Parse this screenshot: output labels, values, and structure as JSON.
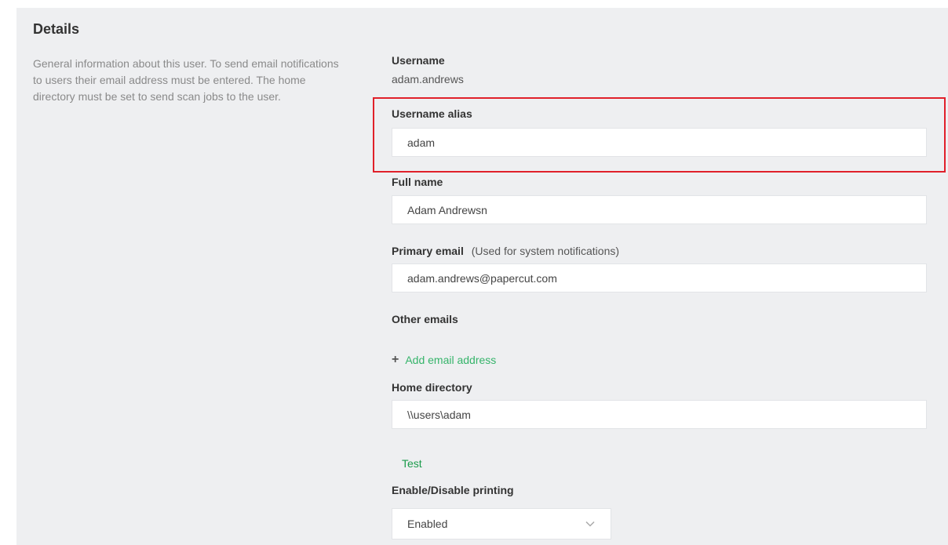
{
  "section": {
    "title": "Details",
    "description": "General information about this user. To send email notifications to users their email address must be entered. The home directory must be set to send scan jobs to the user."
  },
  "username": {
    "label": "Username",
    "value": "adam.andrews"
  },
  "username_alias": {
    "label": "Username alias",
    "value": "adam"
  },
  "full_name": {
    "label": "Full name",
    "value": "Adam Andrewsn"
  },
  "primary_email": {
    "label": "Primary email",
    "note": "(Used for system notifications)",
    "value": "adam.andrews@papercut.com"
  },
  "other_emails": {
    "label": "Other emails",
    "add_link": "Add email address"
  },
  "home_directory": {
    "label": "Home directory",
    "value": "\\\\users\\adam",
    "test_link": "Test"
  },
  "printing": {
    "label": "Enable/Disable printing",
    "selected": "Enabled"
  },
  "colors": {
    "highlight": "#e0202a",
    "link": "#35b46a",
    "panel": "#eeeff1"
  },
  "icons": {
    "add": "plus-icon",
    "dropdown": "chevron-down-icon"
  }
}
